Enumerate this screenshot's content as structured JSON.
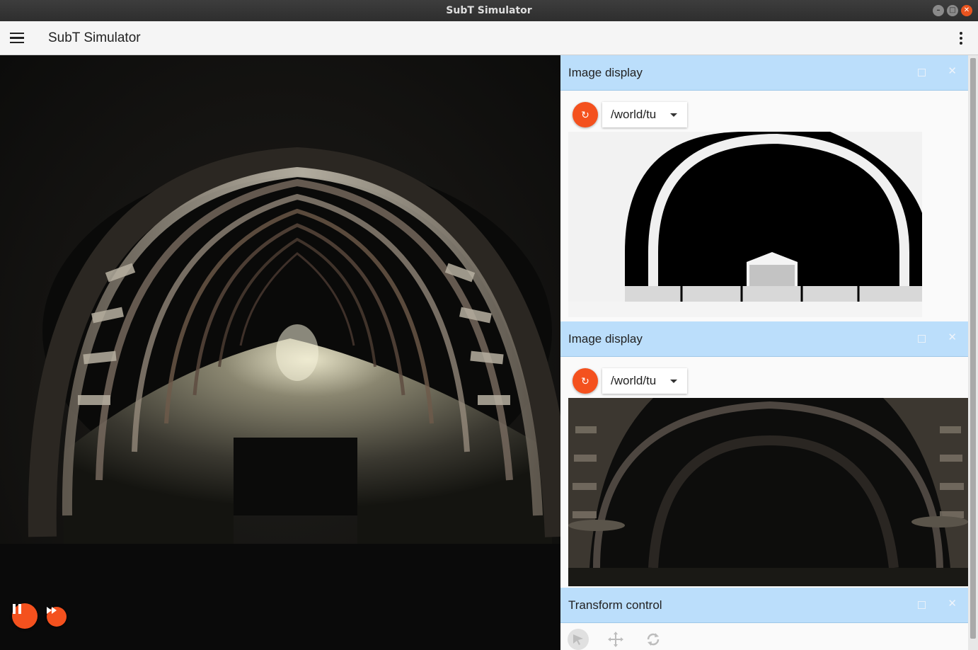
{
  "window": {
    "title": "SubT Simulator"
  },
  "appbar": {
    "title": "SubT Simulator",
    "menu_icon": "hamburger-menu-icon",
    "overflow_icon": "kebab-menu-icon"
  },
  "scene": {
    "controls": {
      "pause_icon": "pause-icon",
      "step_icon": "fast-forward-icon"
    }
  },
  "panels": [
    {
      "title": "Image display",
      "topic": "/world/tu",
      "refresh_icon": "refresh-icon",
      "image": "depth-image"
    },
    {
      "title": "Image display",
      "topic": "/world/tu",
      "refresh_icon": "refresh-icon",
      "image": "camera-image"
    },
    {
      "title": "Transform control",
      "tools": [
        "select-icon",
        "translate-icon",
        "rotate-icon"
      ]
    }
  ],
  "colors": {
    "accent": "#f4511e",
    "panel_header": "#bbdefb",
    "appbar": "#f5f5f5"
  }
}
